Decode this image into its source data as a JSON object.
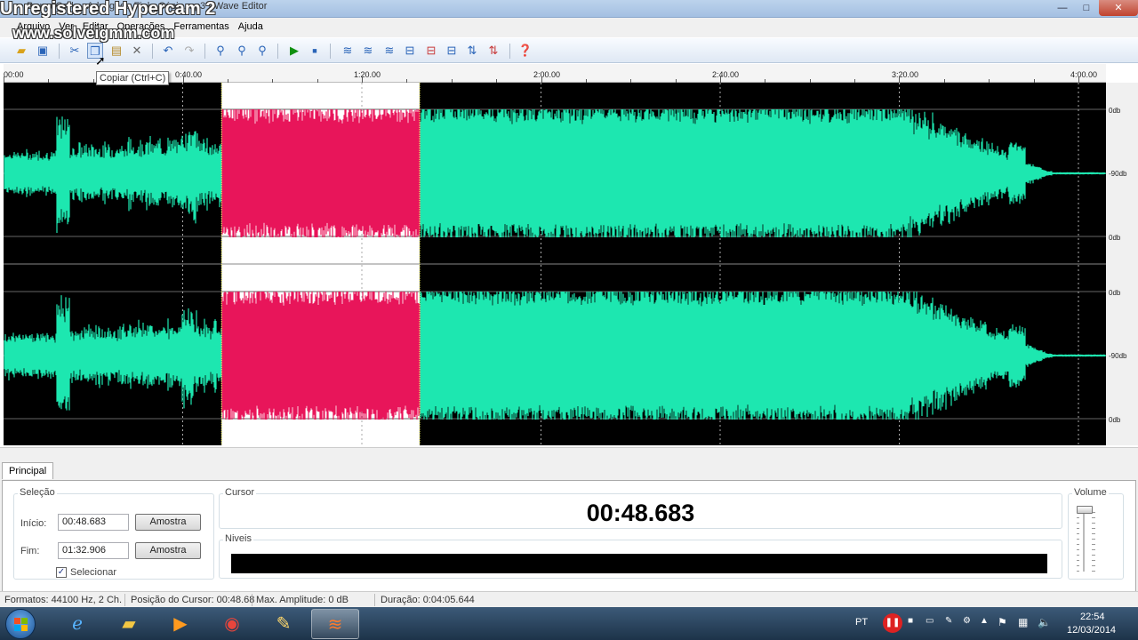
{
  "window": {
    "title": "Bruna Carla - Advogado Fiel - Cópia.mp3 - Wave Editor",
    "watermark_line1": "Unregistered Hypercam 2",
    "watermark_line2": "www.solveigmm.com",
    "minimize": "—",
    "maximize": "□",
    "close": "✕"
  },
  "menu": [
    "Arquivo",
    "Ver",
    "Editar",
    "Operações",
    "Ferramentas",
    "Ajuda"
  ],
  "toolbar": {
    "tooltip": "Copiar (Ctrl+C)",
    "buttons": [
      "open-icon",
      "save-icon",
      "cut-icon",
      "copy-icon",
      "paste-icon",
      "delete-icon",
      "undo-icon",
      "redo-icon",
      "zoom-icon",
      "zoom-in-icon",
      "zoom-out-icon",
      "play-icon",
      "stop-icon",
      "effect-icons",
      "help-icon"
    ]
  },
  "ruler": {
    "labels": [
      "00:00",
      "0:40.00",
      "1:20.00",
      "2:00.00",
      "2:40.00",
      "3:20.00",
      "4:00.00"
    ]
  },
  "wave": {
    "selection_start_s": 48.683,
    "selection_end_s": 92.906,
    "duration_s": 245.644,
    "wave_color": "#1de7b0",
    "selection_color": "#e8155a",
    "db_labels": [
      "0db",
      "-90db",
      "0db",
      "0db",
      "-90db",
      "0db"
    ]
  },
  "panel": {
    "tab": "Principal",
    "selecao": {
      "title": "Seleção",
      "inicio_label": "Início:",
      "inicio_value": "00:48.683",
      "fim_label": "Fim:",
      "fim_value": "01:32.906",
      "amostra": "Amostra",
      "selecionar": "Selecionar",
      "selecionar_checked": true
    },
    "cursor": {
      "title": "Cursor",
      "time": "00:48.683"
    },
    "niveis": {
      "title": "Niveis"
    },
    "volume": {
      "title": "Volume"
    }
  },
  "statusbar": {
    "formatos": "Formatos: 44100 Hz, 2 Ch.",
    "posicao": "Posição do Cursor: 00:48.68",
    "amplitude": "Max. Amplitude: 0 dB",
    "duracao": "Duração: 0:04:05.644"
  },
  "taskbar": {
    "lang": "PT",
    "time": "22:54",
    "date": "12/03/2014",
    "apps": [
      "explorer-icon",
      "ie-icon",
      "folder-icon",
      "media-player-icon",
      "chrome-icon",
      "paint-icon",
      "wave-editor-icon"
    ]
  }
}
